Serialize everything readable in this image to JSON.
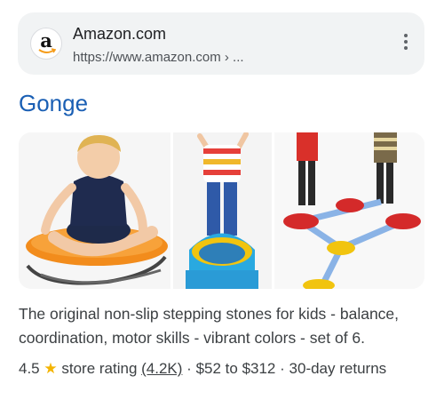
{
  "source": {
    "favicon_letter": "a",
    "favicon_icon": "amazon-logo-icon",
    "site_name": "Amazon.com",
    "url": "https://www.amazon.com › ...",
    "menu_icon": "more-vert-icon"
  },
  "result": {
    "title": "Gonge",
    "images": [
      {
        "icon": "child-on-spinning-seat-image"
      },
      {
        "icon": "child-on-tunnel-image"
      },
      {
        "icon": "children-on-stepping-stones-image"
      }
    ],
    "description": "The original non-slip stepping stones for kids - balance, coordination, motor skills - vibrant colors - set of 6.",
    "rating": "4.5",
    "star_icon": "star-icon",
    "rating_label": "store rating",
    "review_count": "(4.2K)",
    "price_range": "$52 to $312",
    "returns": "30-day returns",
    "separator": "·"
  },
  "colors": {
    "link_blue": "#1a5fb4",
    "star": "#f4b400",
    "card_bg": "#f1f3f4"
  }
}
